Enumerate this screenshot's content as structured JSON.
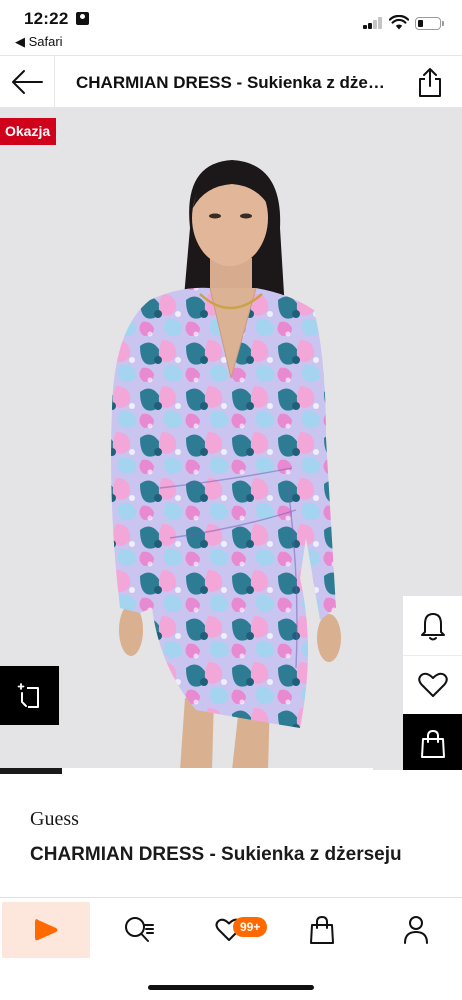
{
  "status_bar": {
    "time": "12:22",
    "back_app_label": "◀ Safari"
  },
  "top_nav": {
    "title": "CHARMIAN DRESS - Sukienka z dżerseju",
    "back_icon": "arrow-left-icon",
    "share_icon": "share-icon"
  },
  "gallery": {
    "deal_badge": "Okazja",
    "image_progress": 0.166,
    "actions": {
      "notify_icon": "bell-icon",
      "wishlist_icon": "heart-icon",
      "bag_icon": "shopping-bag-icon",
      "compare_icon": "compare-icon"
    }
  },
  "product": {
    "brand": "Guess",
    "name": "CHARMIAN DRESS - Sukienka z dżerseju"
  },
  "tab_bar": {
    "wishlist_badge": "99+",
    "tabs": [
      "home-icon",
      "search-icon",
      "heart-icon",
      "shopping-bag-icon",
      "account-icon"
    ]
  },
  "colors": {
    "deal_red": "#d0021b",
    "accent_orange": "#ff6900",
    "home_tab_bg": "#fde6dc"
  }
}
